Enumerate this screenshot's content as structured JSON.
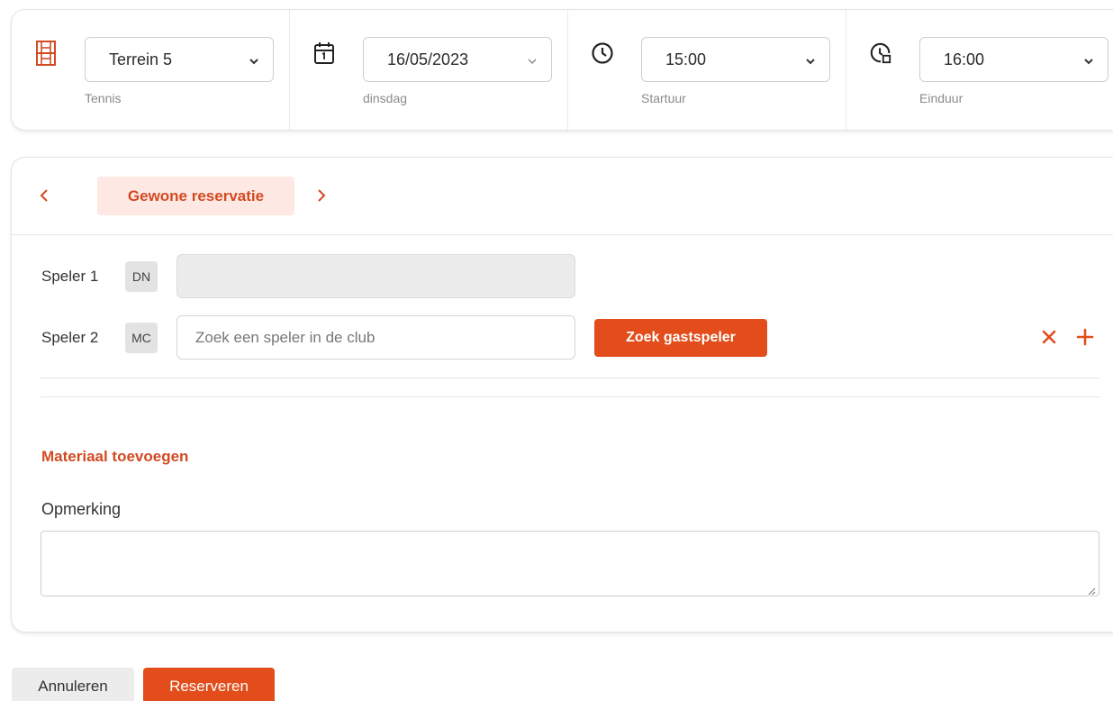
{
  "filters": {
    "court": {
      "value": "Terrein 5",
      "sub": "Tennis",
      "icon": "court-icon"
    },
    "date": {
      "value": "16/05/2023",
      "sub": "dinsdag",
      "icon": "calendar-icon"
    },
    "start": {
      "value": "15:00",
      "sub": "Startuur",
      "icon": "clock-icon"
    },
    "end": {
      "value": "16:00",
      "sub": "Einduur",
      "icon": "clock-stop-icon"
    }
  },
  "reservation_type": {
    "label": "Gewone reservatie"
  },
  "players": [
    {
      "label": "Speler 1",
      "initials": "DN",
      "value": "",
      "placeholder": ""
    },
    {
      "label": "Speler 2",
      "initials": "MC",
      "value": "",
      "placeholder": "Zoek een speler in de club"
    }
  ],
  "guest_button": {
    "label": "Zoek gastspeler"
  },
  "material": {
    "label": "Materiaal toevoegen"
  },
  "remark": {
    "label": "Opmerking",
    "value": ""
  },
  "actions": {
    "cancel": "Annuleren",
    "reserve": "Reserveren"
  },
  "colors": {
    "accent": "#e24d1b",
    "accent_text": "#d24a22",
    "chip_bg": "#fde8e4"
  }
}
